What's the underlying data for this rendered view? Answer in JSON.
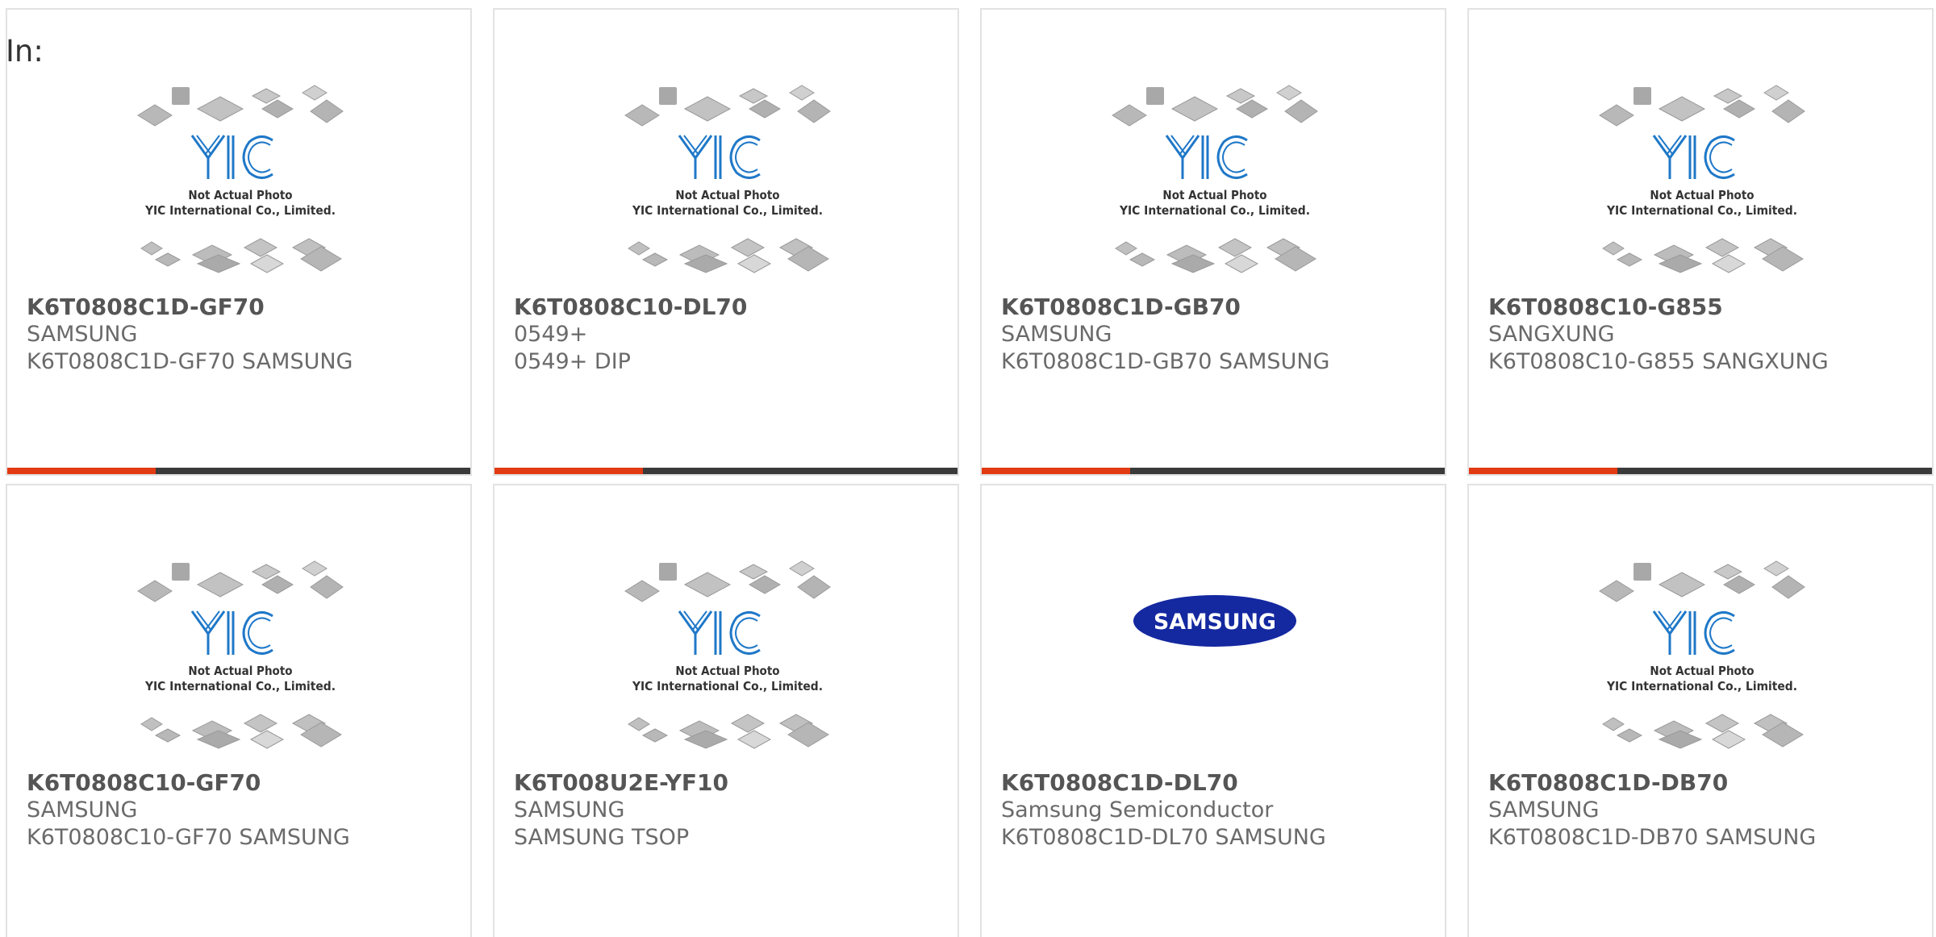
{
  "header": {
    "in_label": "In:"
  },
  "placeholder_image": {
    "line1": "Not Actual Photo",
    "line2": "YIC International Co., Limited.",
    "logo_text": "YIC"
  },
  "samsung_logo_text": "SAMSUNG",
  "colors": {
    "accent": "#e23a12",
    "bar": "#3a3a3a",
    "yic_blue": "#1f78c8",
    "samsung_blue": "#1428a0"
  },
  "products": [
    {
      "part": "K6T0808C1D-GF70",
      "manufacturer": "SAMSUNG",
      "description": "K6T0808C1D-GF70 SAMSUNG",
      "image": "yic-placeholder"
    },
    {
      "part": "K6T0808C10-DL70",
      "manufacturer": "0549+",
      "description": "0549+ DIP",
      "image": "yic-placeholder"
    },
    {
      "part": "K6T0808C1D-GB70",
      "manufacturer": "SAMSUNG",
      "description": "K6T0808C1D-GB70 SAMSUNG",
      "image": "yic-placeholder"
    },
    {
      "part": "K6T0808C10-G855",
      "manufacturer": "SANGXUNG",
      "description": "K6T0808C10-G855 SANGXUNG",
      "image": "yic-placeholder"
    },
    {
      "part": "K6T0808C10-GF70",
      "manufacturer": "SAMSUNG",
      "description": "K6T0808C10-GF70 SAMSUNG",
      "image": "yic-placeholder"
    },
    {
      "part": "K6T008U2E-YF10",
      "manufacturer": "SAMSUNG",
      "description": "SAMSUNG TSOP",
      "image": "yic-placeholder"
    },
    {
      "part": "K6T0808C1D-DL70",
      "manufacturer": "Samsung Semiconductor",
      "description": "K6T0808C1D-DL70 SAMSUNG",
      "image": "samsung-logo"
    },
    {
      "part": "K6T0808C1D-DB70",
      "manufacturer": "SAMSUNG",
      "description": "K6T0808C1D-DB70 SAMSUNG",
      "image": "yic-placeholder"
    }
  ]
}
